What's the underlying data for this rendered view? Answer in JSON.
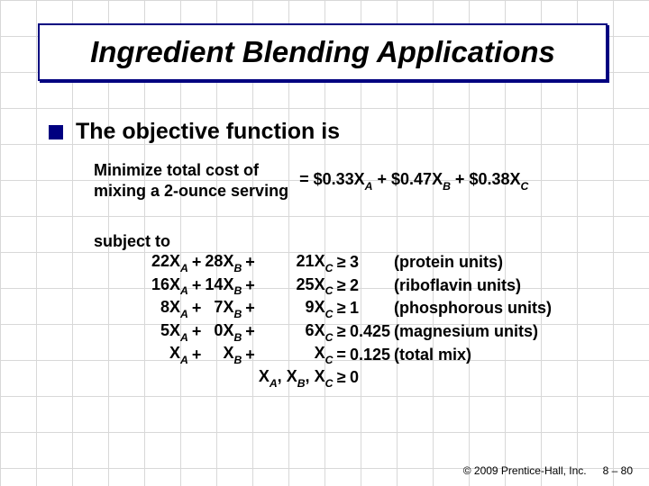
{
  "title": "Ingredient Blending Applications",
  "bullet": "The objective function is",
  "objective": {
    "left_line1": "Minimize total cost of",
    "left_line2": "mixing a 2-ounce serving",
    "eq": "=",
    "c1": "$0.33",
    "v1": "X",
    "s1": "A",
    "p1": " + ",
    "c2": "$0.47",
    "v2": "X",
    "s2": "B",
    "p2": " + ",
    "c3": "$0.38",
    "v3": "X",
    "s3": "C"
  },
  "subject_to": "subject to",
  "rows": [
    {
      "a": "22",
      "b": "28",
      "c": "21",
      "op": "≥",
      "rhs": "3",
      "desc": "(protein units)"
    },
    {
      "a": "16",
      "b": "14",
      "c": "25",
      "op": "≥",
      "rhs": "2",
      "desc": "(riboflavin units)"
    },
    {
      "a": "8",
      "b": "7",
      "c": "9",
      "op": "≥",
      "rhs": "1",
      "desc": "(phosphorous units)"
    },
    {
      "a": "5",
      "b": "0",
      "c": "6",
      "op": "≥",
      "rhs": "0.425",
      "desc": "(magnesium units)"
    },
    {
      "a": "",
      "b": "",
      "c": "",
      "op": "=",
      "rhs": "0.125",
      "desc": "(total mix)"
    }
  ],
  "vars": {
    "xa": "X",
    "sa": "A",
    "xb": "X",
    "sb": "B",
    "xc": "X",
    "sc": "C",
    "plus": "+"
  },
  "nonneg": {
    "lhs": "X",
    "sa": "A",
    "sep": ", ",
    "sb": "B",
    "sc": "C",
    "op": "≥",
    "rhs": "0"
  },
  "footer": {
    "copy": "© 2009 Prentice-Hall, Inc.",
    "page": "8 – 80"
  }
}
